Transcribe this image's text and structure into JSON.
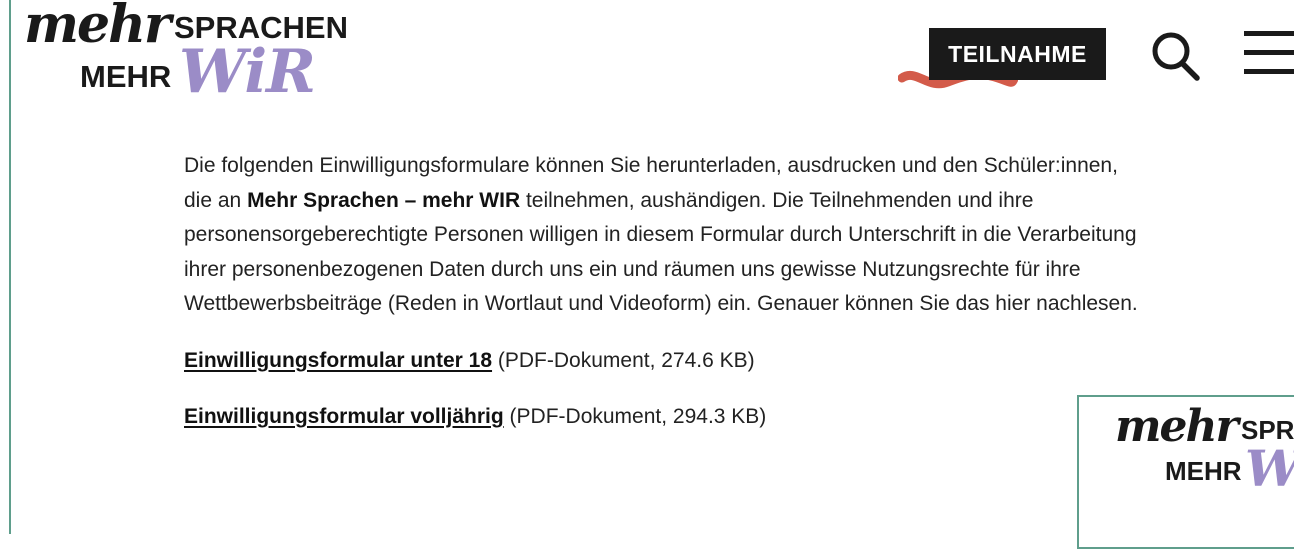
{
  "header": {
    "logo": {
      "script_word": "mehr",
      "caps_top": "SPRACHEN",
      "caps_bottom": "MEHR",
      "wir": "WiR"
    },
    "teilnahme_label": "TEILNAHME",
    "icons": {
      "search": "search-icon",
      "menu": "menu-icon"
    }
  },
  "main": {
    "intro": {
      "part1": "Die folgenden Einwilligungsformulare können Sie herunterladen, ausdrucken und den Schüler:innen, die an ",
      "bold": "Mehr Sprachen – mehr WIR",
      "part2": " teilnehmen, aushändigen. Die Teilnehmenden und ihre personensorgeberechtigte Personen willigen in diesem Formular durch Unterschrift in die Verarbeitung ihrer personenbezogenen Daten durch uns ein und räumen uns gewisse Nutzungsrechte für ihre Wettbewerbsbeiträge (Reden in Wortlaut und Videoform) ein. Genauer können Sie das hier nachlesen."
    },
    "downloads": [
      {
        "label": "Einwilligungsformular unter 18",
        "meta": " (PDF-Dokument, 274.6 KB)"
      },
      {
        "label": "Einwilligungsformular volljährig",
        "meta": " (PDF-Dokument, 294.3 KB)"
      }
    ]
  },
  "side_card": {
    "logo": {
      "script_word": "mehr",
      "caps_top": "SPR",
      "caps_bottom": "MEHR",
      "wir": "W"
    }
  },
  "colors": {
    "accent_green": "#5f9e8c",
    "wir_purple": "#9b8cc7",
    "wave_red": "#d35b4a",
    "dark": "#1a1a1a"
  }
}
